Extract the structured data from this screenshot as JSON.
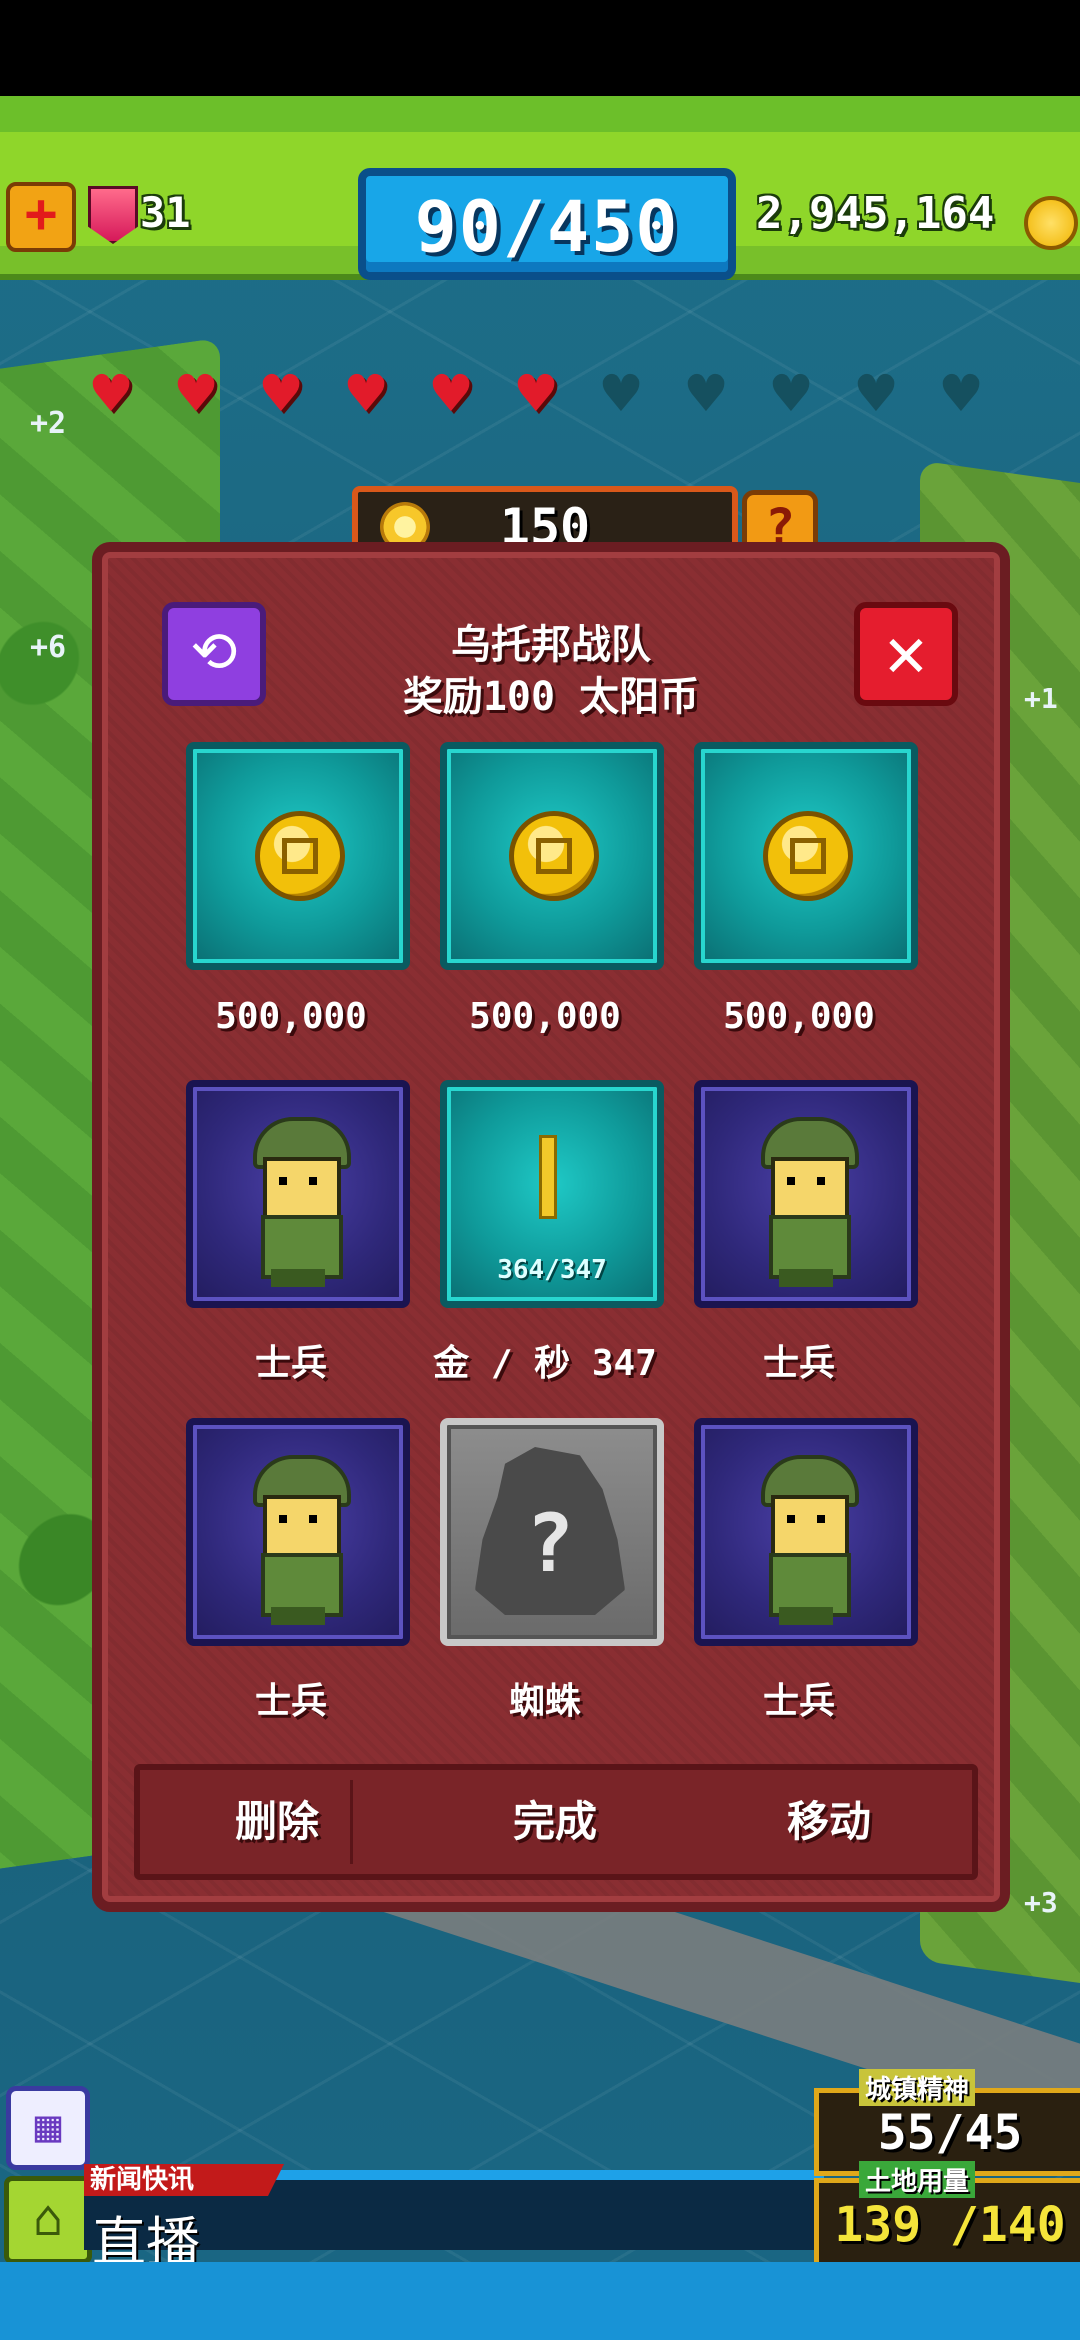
{
  "hud": {
    "gems": "31",
    "population": "90/450",
    "money": "2,945,164"
  },
  "hearts": {
    "filled": 6,
    "total": 11
  },
  "map_bonus": {
    "left_top": "+2",
    "left_mid": "+6",
    "right_top": "+1",
    "right_bottom": "+3"
  },
  "sun_coins": "150",
  "dialog": {
    "title": "乌托邦战队",
    "subtitle": "奖励100 太阳币",
    "slots": [
      {
        "label": "500,000",
        "kind": "coin"
      },
      {
        "label": "500,000",
        "kind": "coin"
      },
      {
        "label": "500,000",
        "kind": "coin"
      },
      {
        "label": "士兵",
        "kind": "soldier"
      },
      {
        "label": "金 / 秒 347",
        "kind": "stack",
        "ratio": "364/347"
      },
      {
        "label": "士兵",
        "kind": "soldier"
      },
      {
        "label": "士兵",
        "kind": "soldier"
      },
      {
        "label": "蜘蛛",
        "kind": "unknown"
      },
      {
        "label": "士兵",
        "kind": "soldier"
      }
    ],
    "buttons": {
      "delete": "删除",
      "complete": "完成",
      "move": "移动"
    }
  },
  "bottom": {
    "news_label": "新闻快讯",
    "live_label": "直播",
    "spirit_label": "城镇精神",
    "spirit_value": "55/45",
    "land_label": "土地用量",
    "land_value": "139 /140"
  },
  "colors": {
    "accent_green": "#8fd62a",
    "pop_blue": "#18a6e8",
    "dialog_red": "#8a2e32",
    "slot_teal": "#0f9a9a",
    "slot_navy": "#2f287a"
  },
  "icons": [
    "plus-icon",
    "gem-icon",
    "coin-icon",
    "sun-coin-icon",
    "help-icon",
    "rotate-icon",
    "close-icon",
    "calendar-icon",
    "home-icon"
  ]
}
